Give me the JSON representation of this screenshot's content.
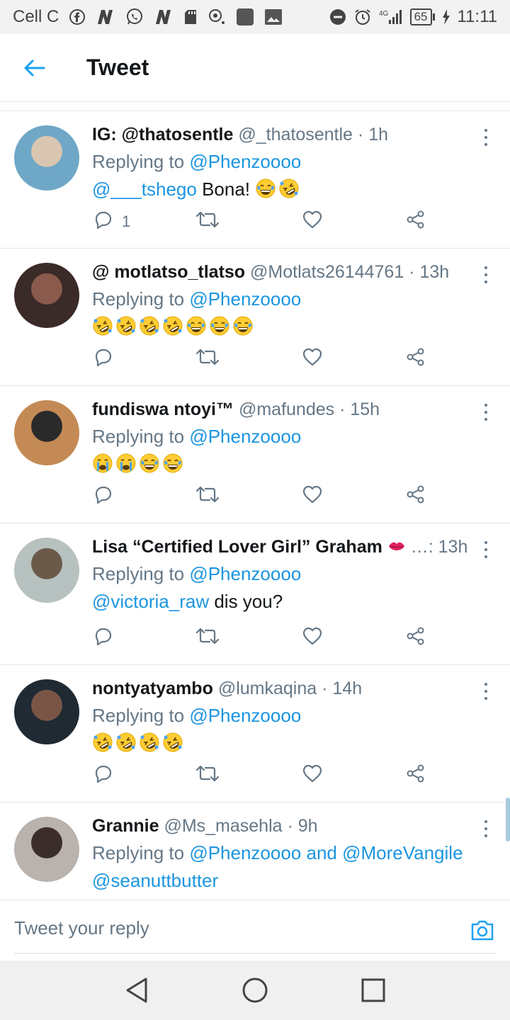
{
  "status_bar": {
    "carrier": "Cell C",
    "network": "4G",
    "battery": "65",
    "time": "11:11"
  },
  "header": {
    "title": "Tweet"
  },
  "tweets": [
    {
      "name": "IG: @thatosentle",
      "handle": "@_thatosentle",
      "time": "1h",
      "replying_prefix": "Replying to",
      "replying_to": "@Phenzoooo",
      "body_mention": "@___tshego",
      "body_text": " Bona!",
      "emojis": [
        "joy",
        "rofl"
      ],
      "reply_count": "1",
      "avatar_colors": [
        "#6fa7c7",
        "#d9c6b0"
      ]
    },
    {
      "name": "@ motlatso_tlatso",
      "handle": "@Motlats26144761",
      "time": "13h",
      "replying_prefix": "Replying to",
      "replying_to": "@Phenzoooo",
      "body_mention": "",
      "body_text": "",
      "emojis": [
        "rofl",
        "rofl",
        "rofl",
        "rofl",
        "joy",
        "joy",
        "joy"
      ],
      "reply_count": "",
      "avatar_colors": [
        "#3a2a28",
        "#8a5a4c"
      ]
    },
    {
      "name": "fundiswa ntoyi™",
      "handle": "@mafundes",
      "time": "15h",
      "replying_prefix": "Replying to",
      "replying_to": "@Phenzoooo",
      "body_mention": "",
      "body_text": "",
      "emojis": [
        "sob",
        "sob",
        "joy",
        "joy"
      ],
      "reply_count": "",
      "avatar_colors": [
        "#c48a55",
        "#2a2a2a"
      ]
    },
    {
      "name": "Lisa “Certified Lover Girl” Graham",
      "name_suffix": "…:",
      "handle": "",
      "time": "13h",
      "replying_prefix": "Replying to",
      "replying_to": "@Phenzoooo",
      "body_mention": "@victoria_raw",
      "body_text": " dis you?",
      "emojis": [],
      "reply_count": "",
      "avatar_colors": [
        "#b7c2c0",
        "#6b5a4a"
      ]
    },
    {
      "name": "nontyatyambo",
      "handle": "@lumkaqina",
      "time": "14h",
      "replying_prefix": "Replying to",
      "replying_to": "@Phenzoooo",
      "body_mention": "",
      "body_text": "",
      "emojis": [
        "rofl",
        "rofl",
        "rofl",
        "rofl"
      ],
      "reply_count": "",
      "avatar_colors": [
        "#1f2a33",
        "#7a5545"
      ]
    },
    {
      "name": "Grannie",
      "handle": "@Ms_masehla",
      "time": "9h",
      "replying_prefix": "Replying to",
      "replying_to": "@Phenzoooo and @MoreVangile",
      "body_mention": "@seanuttbutter",
      "body_text": "",
      "emojis": [],
      "reply_count": "",
      "avatar_colors": [
        "#b9b2ad",
        "#3b2d2a"
      ]
    }
  ],
  "reply_bar": {
    "placeholder": "Tweet your reply"
  },
  "icons": {
    "back": "back-arrow-icon",
    "reply": "reply-icon",
    "retweet": "retweet-icon",
    "like": "heart-icon",
    "share": "share-icon",
    "more": "more-vertical-icon",
    "camera": "camera-icon"
  },
  "colors": {
    "accent": "#1b95e0",
    "muted": "#657786",
    "text": "#14171a"
  }
}
